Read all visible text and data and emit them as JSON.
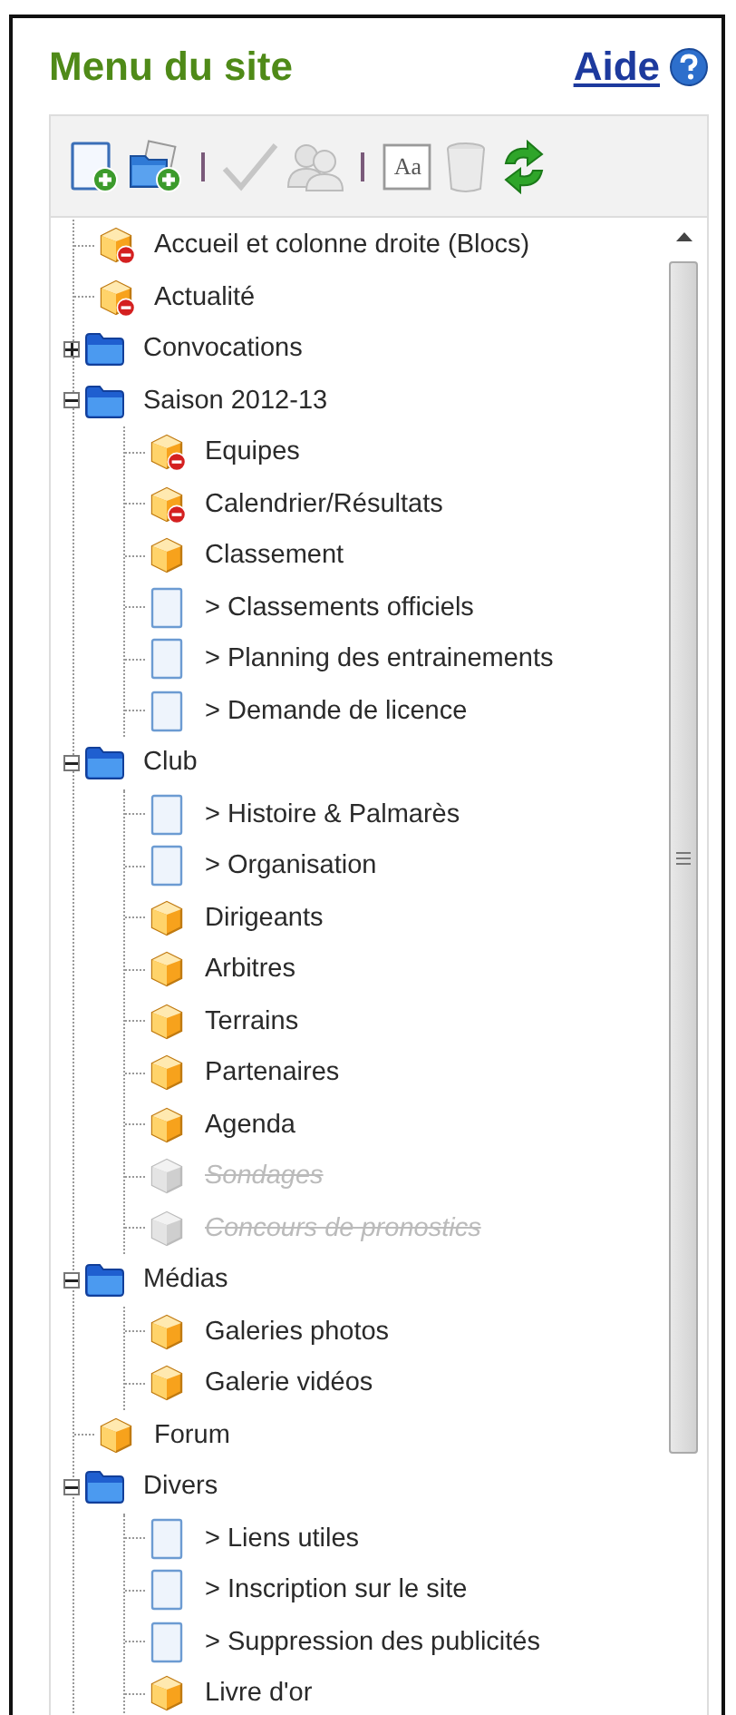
{
  "header": {
    "title": "Menu du site",
    "help_link": "Aide"
  },
  "toolbar": [
    {
      "kind": "new-page",
      "disabled": false
    },
    {
      "kind": "new-folder",
      "disabled": false
    },
    {
      "kind": "separator"
    },
    {
      "kind": "validate",
      "disabled": true
    },
    {
      "kind": "users",
      "disabled": true
    },
    {
      "kind": "separator"
    },
    {
      "kind": "rename",
      "label": "Aa",
      "disabled": false
    },
    {
      "kind": "delete",
      "disabled": true
    },
    {
      "kind": "refresh",
      "disabled": false
    }
  ],
  "tree": [
    {
      "kind": "box",
      "label": "Accueil et colonne droite (Blocs)",
      "restricted": true,
      "disabled": false
    },
    {
      "kind": "box",
      "label": "Actualité",
      "restricted": true,
      "disabled": false
    },
    {
      "kind": "folder",
      "label": "Convocations",
      "expanded": false,
      "disabled": false
    },
    {
      "kind": "folder",
      "label": "Saison 2012-13",
      "expanded": true,
      "disabled": false,
      "children": [
        {
          "kind": "box",
          "label": "Equipes",
          "restricted": true,
          "disabled": false
        },
        {
          "kind": "box",
          "label": "Calendrier/Résultats",
          "restricted": true,
          "disabled": false
        },
        {
          "kind": "box",
          "label": "Classement",
          "restricted": false,
          "disabled": false
        },
        {
          "kind": "page",
          "label": "> Classements officiels",
          "disabled": false
        },
        {
          "kind": "page",
          "label": "> Planning des entrainements",
          "disabled": false
        },
        {
          "kind": "page",
          "label": "> Demande de licence",
          "disabled": false
        }
      ]
    },
    {
      "kind": "folder",
      "label": "Club",
      "expanded": true,
      "disabled": false,
      "children": [
        {
          "kind": "page",
          "label": "> Histoire & Palmarès",
          "disabled": false
        },
        {
          "kind": "page",
          "label": "> Organisation",
          "disabled": false
        },
        {
          "kind": "box",
          "label": "Dirigeants",
          "restricted": false,
          "disabled": false
        },
        {
          "kind": "box",
          "label": "Arbitres",
          "restricted": false,
          "disabled": false
        },
        {
          "kind": "box",
          "label": "Terrains",
          "restricted": false,
          "disabled": false
        },
        {
          "kind": "box",
          "label": "Partenaires",
          "restricted": false,
          "disabled": false
        },
        {
          "kind": "box",
          "label": "Agenda",
          "restricted": false,
          "disabled": false
        },
        {
          "kind": "box",
          "label": "Sondages",
          "restricted": false,
          "disabled": true
        },
        {
          "kind": "box",
          "label": "Concours de pronostics",
          "restricted": false,
          "disabled": true
        }
      ]
    },
    {
      "kind": "folder",
      "label": "Médias",
      "expanded": true,
      "disabled": false,
      "children": [
        {
          "kind": "box",
          "label": "Galeries photos",
          "restricted": false,
          "disabled": false
        },
        {
          "kind": "box",
          "label": "Galerie vidéos",
          "restricted": false,
          "disabled": false
        }
      ]
    },
    {
      "kind": "box",
      "label": "Forum",
      "restricted": false,
      "disabled": false
    },
    {
      "kind": "folder",
      "label": "Divers",
      "expanded": true,
      "disabled": false,
      "children": [
        {
          "kind": "page",
          "label": "> Liens utiles",
          "disabled": false
        },
        {
          "kind": "page",
          "label": "> Inscription sur le site",
          "disabled": false
        },
        {
          "kind": "page",
          "label": "> Suppression des publicités",
          "disabled": false
        },
        {
          "kind": "box",
          "label": "Livre d'or",
          "restricted": false,
          "disabled": false
        }
      ]
    }
  ]
}
